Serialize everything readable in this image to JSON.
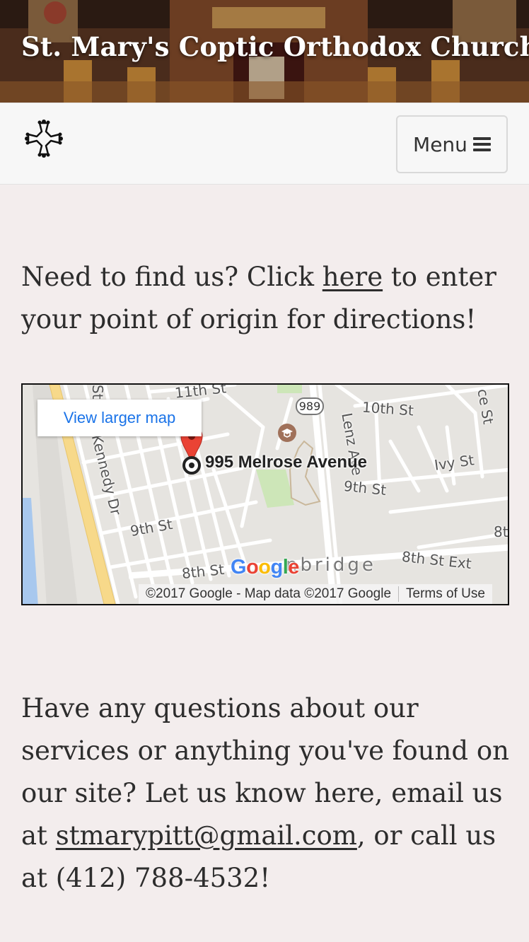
{
  "header": {
    "site_title": "St. Mary's Coptic Orthodox Church"
  },
  "navbar": {
    "logo_icon": "coptic-cross-icon",
    "menu_label": "Menu",
    "menu_icon": "hamburger-icon"
  },
  "directions": {
    "text_before": "Need to find us? Click ",
    "link_text": "here",
    "text_after": " to enter your point of origin for directions!"
  },
  "map": {
    "larger_map_label": "View larger map",
    "address_label": "995 Melrose Avenue",
    "route_number": "989",
    "street_labels": {
      "s11th": "11th St",
      "s10th": "10th St",
      "ivy": "Ivy St",
      "s9th_east": "9th St",
      "s9th_west": "9th St",
      "s8th": "8th St",
      "s8th_ext": "8th St Ext",
      "kennedy": "Kennedy Dr",
      "lenz": "Lenz Ave",
      "ce_st": "ce St",
      "st_left": "St",
      "cambridge": "nbridge",
      "edge_8t": "8t"
    },
    "google_logo": [
      "G",
      "o",
      "o",
      "g",
      "l",
      "e"
    ],
    "google_colors": [
      "#4285F4",
      "#EA4335",
      "#FBBC05",
      "#4285F4",
      "#34A853",
      "#EA4335"
    ],
    "copyright": "©2017 Google - Map data ©2017 Google",
    "terms": "Terms of Use"
  },
  "contact": {
    "text_before": "Have any questions about our services or anything you've found on our site? Let us know here, email us at ",
    "email": "stmarypitt@gmail.com",
    "text_after": ", or call us at (412) 788-4532!"
  }
}
